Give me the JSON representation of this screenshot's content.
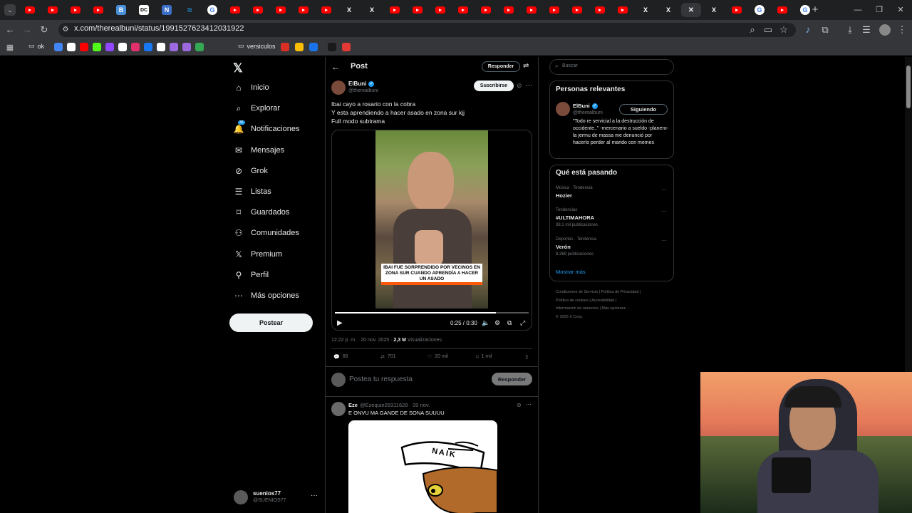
{
  "browser": {
    "url": "x.com/therealbuni/status/1991527623412031922",
    "tabs": [
      {
        "icon": "youtube-icon",
        "color": "#ff0000"
      },
      {
        "icon": "youtube-icon",
        "color": "#ff0000"
      },
      {
        "icon": "youtube-icon",
        "color": "#ff0000"
      },
      {
        "icon": "youtube-icon",
        "color": "#ff0000"
      },
      {
        "icon": "b-icon",
        "color": "#4a90d9",
        "letter": "B"
      },
      {
        "icon": "dc-icon",
        "color": "#ffffff",
        "letter": "DC"
      },
      {
        "icon": "n-icon",
        "color": "#3b6fc7",
        "letter": "N"
      },
      {
        "icon": "wave-icon",
        "color": "#1da1f2"
      },
      {
        "icon": "google-icon",
        "color": "#ffffff",
        "letter": "G"
      },
      {
        "icon": "youtube-icon",
        "color": "#ff0000"
      },
      {
        "icon": "youtube-icon",
        "color": "#ff0000"
      },
      {
        "icon": "youtube-icon",
        "color": "#ff0000"
      },
      {
        "icon": "youtube-icon",
        "color": "#ff0000"
      },
      {
        "icon": "youtube-icon",
        "color": "#ff0000"
      },
      {
        "icon": "x-icon",
        "color": "#ffffff",
        "letter": "X"
      },
      {
        "icon": "x-icon",
        "color": "#ffffff",
        "letter": "X"
      },
      {
        "icon": "youtube-icon",
        "color": "#ff0000"
      },
      {
        "icon": "youtube-icon",
        "color": "#ff0000"
      },
      {
        "icon": "youtube-icon",
        "color": "#ff0000"
      },
      {
        "icon": "youtube-icon",
        "color": "#ff0000"
      },
      {
        "icon": "youtube-icon",
        "color": "#ff0000"
      },
      {
        "icon": "youtube-icon",
        "color": "#ff0000"
      },
      {
        "icon": "youtube-icon",
        "color": "#ff0000"
      },
      {
        "icon": "youtube-icon",
        "color": "#ff0000"
      },
      {
        "icon": "youtube-icon",
        "color": "#ff0000"
      },
      {
        "icon": "youtube-icon",
        "color": "#ff0000"
      },
      {
        "icon": "youtube-icon",
        "color": "#ff0000"
      },
      {
        "icon": "x-icon",
        "color": "#ffffff",
        "letter": "X"
      },
      {
        "icon": "x-icon",
        "color": "#ffffff",
        "letter": "X"
      },
      {
        "icon": "close-icon",
        "color": "#e8eaed",
        "letter": "✕"
      },
      {
        "icon": "x-icon",
        "color": "#ffffff",
        "letter": "X"
      },
      {
        "icon": "youtube-icon",
        "color": "#ff0000"
      },
      {
        "icon": "google-icon",
        "color": "#ffffff",
        "letter": "G"
      },
      {
        "icon": "youtube-icon",
        "color": "#ff0000"
      },
      {
        "icon": "google-icon",
        "color": "#ffffff",
        "letter": "G"
      }
    ],
    "bookmarks": {
      "ok": "ok",
      "folder": "versiculos"
    }
  },
  "sidebar": {
    "items": [
      {
        "label": "Inicio",
        "icon": "home-icon"
      },
      {
        "label": "Explorar",
        "icon": "search-icon"
      },
      {
        "label": "Notificaciones",
        "icon": "bell-icon",
        "badge": "36"
      },
      {
        "label": "Mensajes",
        "icon": "mail-icon"
      },
      {
        "label": "Grok",
        "icon": "grok-icon"
      },
      {
        "label": "Listas",
        "icon": "list-icon"
      },
      {
        "label": "Guardados",
        "icon": "bookmark-icon"
      },
      {
        "label": "Comunidades",
        "icon": "people-icon"
      },
      {
        "label": "Premium",
        "icon": "x-icon"
      },
      {
        "label": "Perfil",
        "icon": "person-icon"
      },
      {
        "label": "Más opciones",
        "icon": "more-circle-icon"
      }
    ],
    "post_button": "Postear",
    "account": {
      "name": "suenios77",
      "handle": "@SUENIOS77"
    }
  },
  "post": {
    "header_title": "Post",
    "reply_button": "Responder",
    "author": {
      "name": "ElBuni",
      "handle": "@therealbuni"
    },
    "subscribe_button": "Suscribirse",
    "text_lines": [
      "Ibai cayo a rosario con la cobra",
      "Y esta aprendiendo a hacer asado en zona sur kjj",
      "Full modo subtrama"
    ],
    "video": {
      "caption": "IBAI FUE SORPRENDIDO POR VECINOS EN ZONA SUR CUANDO APRENDÍA A HACER UN ASADO",
      "time": "0:25 / 0:30",
      "progress": 0.83
    },
    "meta": {
      "time": "12:22 p. m. · 20 nov. 2025 · ",
      "views": "2,3 M",
      "views_label": " Visualizaciones"
    },
    "stats": {
      "replies": "66",
      "reposts": "701",
      "likes": "20 mil",
      "bookmarks": "1 mil"
    },
    "reply_placeholder": "Postea tu respuesta",
    "reply_submit": "Responder"
  },
  "reply": {
    "name": "Eze",
    "handle": "@Ezequie28311628 · 20 nov.",
    "text": "E ONVU MA GANDE DE SONA SUUUU",
    "image_text": "NAIK"
  },
  "right": {
    "search_placeholder": "Buscar",
    "relevant_title": "Personas relevantes",
    "relevant": {
      "name": "ElBuni",
      "handle": "@therealbuni",
      "button": "Siguiendo",
      "bio": "\"Todo re servicial a la destrucción de occidente..\" -mercenario a sueldo -planero- la jermu de massa me denunció por hacerlo perder al marido con memes"
    },
    "trending_title": "Qué está pasando",
    "trends": [
      {
        "context": "Música · Tendencia",
        "name": "Hozier",
        "count": ""
      },
      {
        "context": "Tendencias",
        "name": "#ULTIMAHORA",
        "count": "38,1 mil publicaciones"
      },
      {
        "context": "Deportes · Tendencia",
        "name": "Verón",
        "count": "8.369 publicaciones"
      }
    ],
    "show_more": "Mostrar más",
    "footer_lines": [
      "Condiciones de Servicio  |  Política de Privacidad  |",
      "Política de cookies  |  Accesibilidad  |",
      "Información de anuncios  |  Más opciones ···",
      "© 2025 X Corp."
    ]
  },
  "colors": {
    "accent": "#1d9bf0",
    "youtube": "#ff0000",
    "muted": "#71767b",
    "border": "#2f3336"
  }
}
